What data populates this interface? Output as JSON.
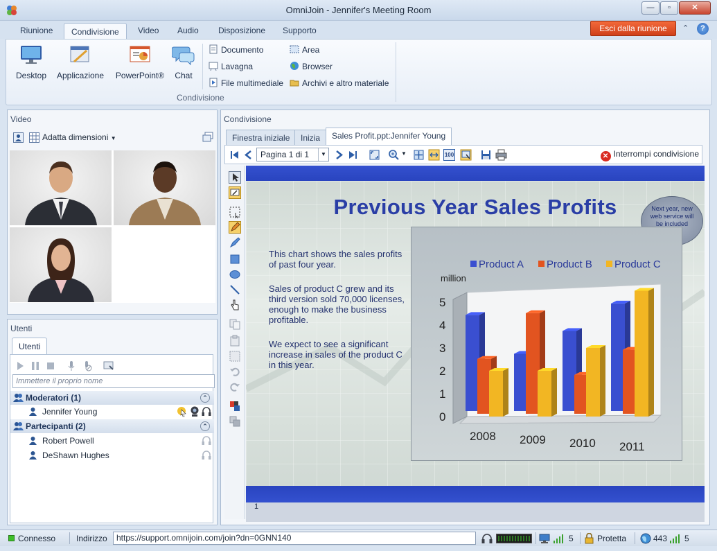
{
  "window": {
    "title": "OmniJoin - Jennifer's Meeting Room",
    "minimize": "—",
    "maximize": "▫",
    "close": "✕"
  },
  "tabs": [
    {
      "label": "Riunione"
    },
    {
      "label": "Condivisione"
    },
    {
      "label": "Video"
    },
    {
      "label": "Audio"
    },
    {
      "label": "Disposizione"
    },
    {
      "label": "Supporto"
    }
  ],
  "exit_button": "Esci dalla riunione",
  "ribbon": {
    "big": [
      {
        "label": "Desktop",
        "icon": "desktop-icon"
      },
      {
        "label": "Applicazione",
        "icon": "application-icon"
      },
      {
        "label": "PowerPoint®",
        "icon": "powerpoint-icon"
      },
      {
        "label": "Chat",
        "icon": "chat-icon"
      }
    ],
    "small_col1": [
      {
        "label": "Documento",
        "icon": "document-icon"
      },
      {
        "label": "Lavagna",
        "icon": "whiteboard-icon"
      },
      {
        "label": "File multimediale",
        "icon": "media-file-icon"
      }
    ],
    "small_col2": [
      {
        "label": "Area",
        "icon": "area-icon"
      },
      {
        "label": "Browser",
        "icon": "globe-icon"
      },
      {
        "label": "Archivi e altro materiale",
        "icon": "folder-icon"
      }
    ],
    "group_label": "Condivisione"
  },
  "video_panel": {
    "title": "Video",
    "fit_label": "Adatta dimensioni"
  },
  "users_panel": {
    "title": "Utenti",
    "tab": "Utenti",
    "name_placeholder": "Immettere il proprio nome",
    "moderators_header": "Moderatori (1)",
    "moderators": [
      "Jennifer Young"
    ],
    "participants_header": "Partecipanti (2)",
    "participants": [
      "Robert Powell",
      "DeShawn Hughes"
    ]
  },
  "sharing_panel": {
    "title": "Condivisione",
    "tabs": [
      "Finestra iniziale",
      "Inizia",
      "Sales Profit.ppt:Jennifer Young"
    ],
    "page_select": "Pagina 1 di 1",
    "stop_sharing": "Interrompi condivisione"
  },
  "slide": {
    "title": "Previous Year Sales Profits",
    "paragraphs": [
      "This chart shows the sales profits of past four year.",
      "Sales of product C grew and its third version sold 70,000 licenses, enough to make the business profitable.",
      "We expect to see a significant increase in sales of the product C in this year."
    ],
    "bubble": "Next year, new web service will be included",
    "page_number": "1"
  },
  "chart_data": {
    "type": "bar",
    "categories": [
      "2008",
      "2009",
      "2010",
      "2011"
    ],
    "series": [
      {
        "name": "Product A",
        "values": [
          4.2,
          2.5,
          3.5,
          4.7
        ],
        "color": "#3a4fd0"
      },
      {
        "name": "Product B",
        "values": [
          2.4,
          4.4,
          1.7,
          2.8
        ],
        "color": "#e25420"
      },
      {
        "name": "Product C",
        "values": [
          2.0,
          2.0,
          3.0,
          5.5
        ],
        "color": "#f2b623"
      }
    ],
    "ylabel": "million",
    "ylim": [
      0,
      5
    ],
    "yticks": [
      "0",
      "1",
      "2",
      "3",
      "4",
      "5"
    ],
    "legend": "top"
  },
  "statusbar": {
    "connection": "Connesso",
    "address_label": "Indirizzo",
    "address": "https://support.omnijoin.com/join?dn=0GNN140",
    "viewers": "5",
    "security": "Protetta",
    "latency": "443",
    "signal": "5"
  }
}
